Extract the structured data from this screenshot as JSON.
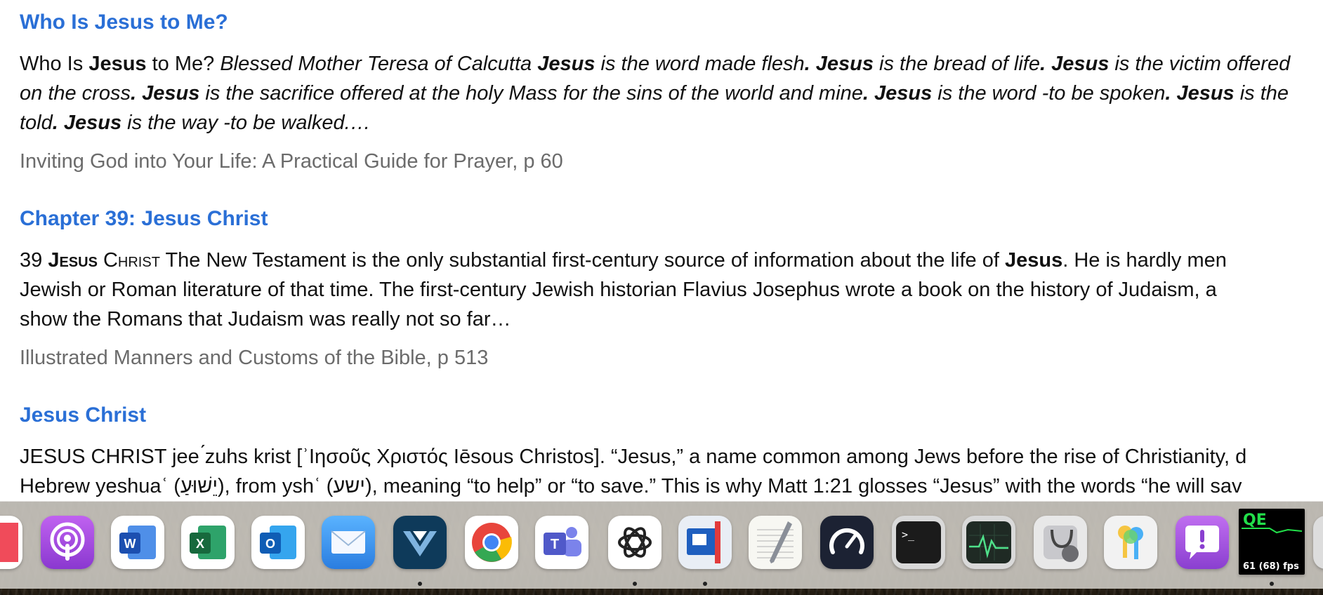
{
  "results": [
    {
      "title": "Who Is Jesus to Me?",
      "excerpt": [
        [
          {
            "t": "Who Is ",
            "s": "n"
          },
          {
            "t": "Jesus",
            "s": "b"
          },
          {
            "t": " to Me? ",
            "s": "n"
          },
          {
            "t": "Blessed Mother Teresa of Calcutta ",
            "s": "i"
          },
          {
            "t": "Jesus",
            "s": "bi"
          },
          {
            "t": " is the word made flesh",
            "s": "i"
          },
          {
            "t": ". Jesus",
            "s": "bi"
          },
          {
            "t": " is the bread of life",
            "s": "i"
          },
          {
            "t": ". Jesus",
            "s": "bi"
          },
          {
            "t": " is the victim offered",
            "s": "i"
          }
        ],
        [
          {
            "t": "on the cross",
            "s": "i"
          },
          {
            "t": ". Jesus",
            "s": "bi"
          },
          {
            "t": " is the sacrifice offered at the holy Mass for the sins of the world and mine",
            "s": "i"
          },
          {
            "t": ". Jesus",
            "s": "bi"
          },
          {
            "t": " is the word -to be spoken",
            "s": "i"
          },
          {
            "t": ". Jesus",
            "s": "bi"
          },
          {
            "t": " is the",
            "s": "i"
          }
        ],
        [
          {
            "t": "told",
            "s": "i"
          },
          {
            "t": ". Jesus",
            "s": "bi"
          },
          {
            "t": " is the way -to be walked.…",
            "s": "i"
          }
        ]
      ],
      "source": "Inviting God into Your Life: A Practical Guide for Prayer, p 60"
    },
    {
      "title": "Chapter 39: Jesus Christ",
      "excerpt": [
        [
          {
            "t": "39 ",
            "s": "n"
          },
          {
            "t": "Jesus",
            "s": "bsc"
          },
          {
            "t": " Christ",
            "s": "sc"
          },
          {
            "t": " The New Testament is the only substantial first-century source of information about the life of ",
            "s": "n"
          },
          {
            "t": "Jesus",
            "s": "b"
          },
          {
            "t": ". He is hardly men",
            "s": "n"
          }
        ],
        [
          {
            "t": "Jewish or Roman literature of that time. The first-century Jewish historian Flavius Josephus wrote a book on the history of Judaism, a",
            "s": "n"
          }
        ],
        [
          {
            "t": "show the Romans that Judaism was really not so far…",
            "s": "n"
          }
        ]
      ],
      "source": "Illustrated Manners and Customs of the Bible, p 513"
    },
    {
      "title": "Jesus Christ",
      "excerpt": [
        [
          {
            "t": "JESUS CHRIST jee ́zuhs krist [ʾΙησοῦς Χριστός Iēsous Christos]. “Jesus,” a name common among Jews before the rise of Christianity, d",
            "s": "n"
          }
        ],
        [
          {
            "t": "Hebrew yeshuaʿ (יֵשׁוּעַ), from yshʿ (ישע), meaning “to help” or “to save.” This is why Matt 1:21 glosses “Jesus” with the words “he will sav",
            "s": "n"
          }
        ]
      ],
      "source": ""
    }
  ],
  "dock": {
    "apps": [
      {
        "name": "News",
        "icon": "news-icon",
        "color": "#f04b5a"
      },
      {
        "name": "Podcasts",
        "icon": "podcasts-icon",
        "color": "#9b4fd6"
      },
      {
        "name": "Microsoft Word",
        "icon": "word-icon",
        "color": "#2b5cc4",
        "letter": "W"
      },
      {
        "name": "Microsoft Excel",
        "icon": "excel-icon",
        "color": "#1f7a44",
        "letter": "X"
      },
      {
        "name": "Microsoft Outlook",
        "icon": "outlook-icon",
        "color": "#1e73c8",
        "letter": "O"
      },
      {
        "name": "Mail",
        "icon": "mail-icon",
        "color": "#3d9bf0"
      },
      {
        "name": "Logos",
        "icon": "logos-icon",
        "color": "#0e3a5a"
      },
      {
        "name": "Google Chrome",
        "icon": "chrome-icon",
        "color": "#ffffff"
      },
      {
        "name": "Microsoft Teams",
        "icon": "teams-icon",
        "color": "#5b5fc7",
        "letter": "T"
      },
      {
        "name": "ChatGPT",
        "icon": "chatgpt-icon",
        "color": "#ffffff"
      },
      {
        "name": "Parallels Desktop",
        "icon": "parallels-icon",
        "color": "#d93a3a"
      },
      {
        "name": "TextEdit",
        "icon": "textedit-icon",
        "color": "#f7f7f2"
      },
      {
        "name": "Speedtest",
        "icon": "speedtest-icon",
        "color": "#1c2233"
      },
      {
        "name": "Terminal",
        "icon": "terminal-icon",
        "color": "#1b1b1b",
        "text": ">_"
      },
      {
        "name": "Activity Monitor",
        "icon": "activity-monitor-icon",
        "color": "#1f2a24"
      },
      {
        "name": "Disk Utility",
        "icon": "disk-utility-icon",
        "color": "#e8e8e8"
      },
      {
        "name": "Passwords",
        "icon": "passwords-icon",
        "color": "#f2f2f2"
      },
      {
        "name": "Feedback Assistant",
        "icon": "feedback-icon",
        "color": "#a64bd8",
        "text": "!"
      },
      {
        "name": "Quartz Debug",
        "icon": "quartz-debug-icon",
        "color": "#000000",
        "label": "QE",
        "fps": "61 (68) fps"
      }
    ]
  }
}
